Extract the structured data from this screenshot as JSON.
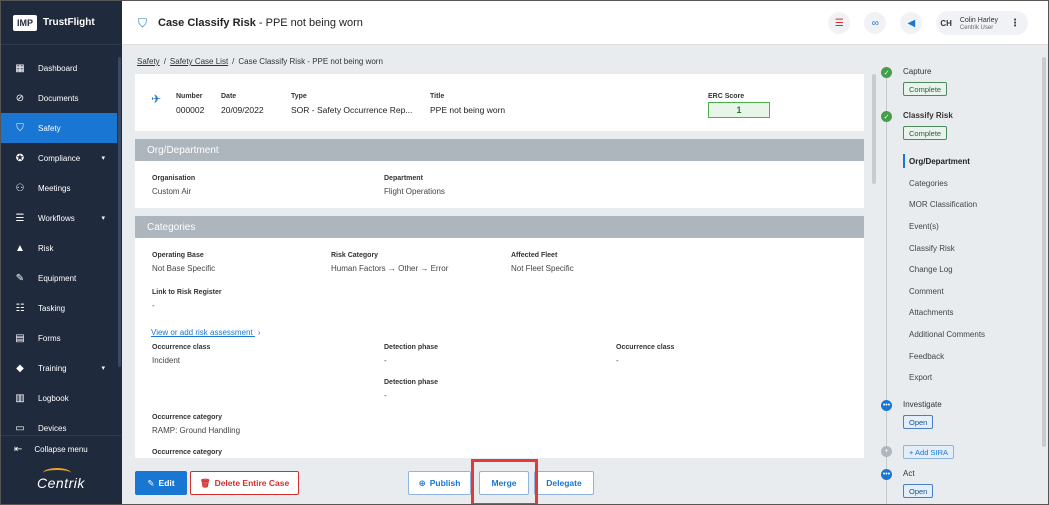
{
  "brand": {
    "logo": "IMP",
    "name": "TrustFlight"
  },
  "nav": {
    "items": [
      {
        "label": "Dashboard",
        "icon": "dashboard-icon",
        "glyph": "▦",
        "chevron": false
      },
      {
        "label": "Documents",
        "icon": "paperclip-icon",
        "glyph": "⊘",
        "chevron": false
      },
      {
        "label": "Safety",
        "icon": "shield-icon",
        "glyph": "⛉",
        "chevron": false,
        "active": true
      },
      {
        "label": "Compliance",
        "icon": "badge-icon",
        "glyph": "✪",
        "chevron": true
      },
      {
        "label": "Meetings",
        "icon": "people-icon",
        "glyph": "⚇",
        "chevron": false
      },
      {
        "label": "Workflows",
        "icon": "stack-icon",
        "glyph": "☰",
        "chevron": true
      },
      {
        "label": "Risk",
        "icon": "warning-icon",
        "glyph": "▲",
        "chevron": false
      },
      {
        "label": "Equipment",
        "icon": "wrench-icon",
        "glyph": "✎",
        "chevron": false
      },
      {
        "label": "Tasking",
        "icon": "tasks-icon",
        "glyph": "☷",
        "chevron": false
      },
      {
        "label": "Forms",
        "icon": "form-icon",
        "glyph": "▤",
        "chevron": false
      },
      {
        "label": "Training",
        "icon": "graduation-cap-icon",
        "glyph": "◆",
        "chevron": true
      },
      {
        "label": "Logbook",
        "icon": "book-icon",
        "glyph": "▥",
        "chevron": false
      },
      {
        "label": "Devices",
        "icon": "device-icon",
        "glyph": "▭",
        "chevron": false
      }
    ],
    "collapse_label": "Collapse menu",
    "footer_logo": "Centrik"
  },
  "header": {
    "title_bold": "Case Classify Risk",
    "title_rest": " - PPE not being worn",
    "user_initials": "CH",
    "user_name": "Colin Harley",
    "user_role": "Centrik User"
  },
  "breadcrumb": {
    "items": [
      "Safety",
      "Safety Case List"
    ],
    "current": "Case Classify Risk - PPE not being worn"
  },
  "summary": {
    "number_label": "Number",
    "number": "000002",
    "date_label": "Date",
    "date": "20/09/2022",
    "type_label": "Type",
    "type": "SOR - Safety Occurrence Rep...",
    "title_label": "Title",
    "title": "PPE not being worn",
    "erc_label": "ERC Score",
    "erc": "1"
  },
  "org": {
    "heading": "Org/Department",
    "organisation_label": "Organisation",
    "organisation": "Custom Air",
    "department_label": "Department",
    "department": "Flight Operations"
  },
  "categories": {
    "heading": "Categories",
    "operating_base_label": "Operating Base",
    "operating_base": "Not Base Specific",
    "risk_category_label": "Risk Category",
    "risk_category": "Human Factors → Other → Error",
    "affected_fleet_label": "Affected Fleet",
    "affected_fleet": "Not Fleet Specific",
    "link_register_label": "Link to Risk Register",
    "link_register": "-",
    "risk_link": "View or add risk assessment",
    "occ_class_label": "Occurrence class",
    "occ_class": "Incident",
    "detection_label": "Detection phase",
    "detection": "-",
    "occ_class2_label": "Occurrence class",
    "occ_class2": "-",
    "detection2_label": "Detection phase",
    "detection2": "-",
    "occ_category_label": "Occurrence category",
    "occ_category": "RAMP: Ground Handling",
    "occ_category2_label": "Occurrence category"
  },
  "actions": {
    "edit": "Edit",
    "delete": "Delete Entire Case",
    "publish": "Publish",
    "merge": "Merge",
    "delegate": "Delegate"
  },
  "workflow": {
    "capture": "Capture",
    "capture_status": "Complete",
    "classify": "Classify Risk",
    "classify_status": "Complete",
    "sections": [
      "Org/Department",
      "Categories",
      "MOR Classification",
      "Event(s)",
      "Classify Risk",
      "Change Log",
      "Comment",
      "Attachments",
      "Additional Comments",
      "Feedback",
      "Export"
    ],
    "investigate": "Investigate",
    "investigate_status": "Open",
    "add_sira": "+ Add SIRA",
    "act": "Act",
    "act_status": "Open"
  },
  "colors": {
    "sidebar": "#1f2a3c",
    "accent": "#1976d2",
    "success": "#43a047",
    "danger": "#d32f2f",
    "section_head": "#adb5bd"
  }
}
